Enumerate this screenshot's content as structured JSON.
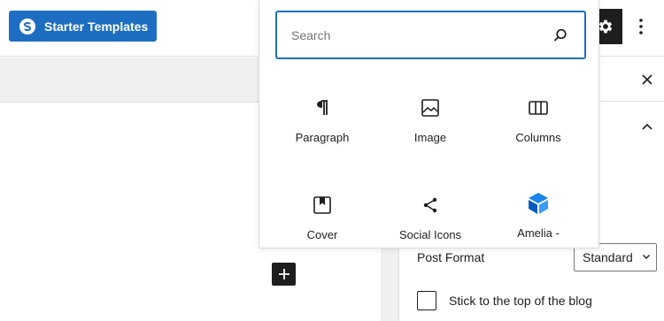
{
  "toolbar": {
    "starter_templates_label": "Starter Templates",
    "settings_icon": "gear-icon",
    "more_icon": "vertical-ellipsis-icon"
  },
  "inserter": {
    "search_placeholder": "Search",
    "blocks": [
      {
        "label": "Paragraph",
        "icon": "paragraph-icon"
      },
      {
        "label": "Image",
        "icon": "image-icon"
      },
      {
        "label": "Columns",
        "icon": "columns-icon"
      },
      {
        "label": "Cover",
        "icon": "cover-icon"
      },
      {
        "label": "Social Icons",
        "icon": "share-icon"
      },
      {
        "label": "Amelia -",
        "icon": "amelia-logo-icon"
      }
    ]
  },
  "sidebar": {
    "post_format_label": "Post Format",
    "post_format_value": "Standard",
    "sticky_label": "Stick to the top of the blog"
  },
  "colors": {
    "accent": "#1d6ec2",
    "dark": "#1e1e1e",
    "amelia": "#1a84ee"
  }
}
